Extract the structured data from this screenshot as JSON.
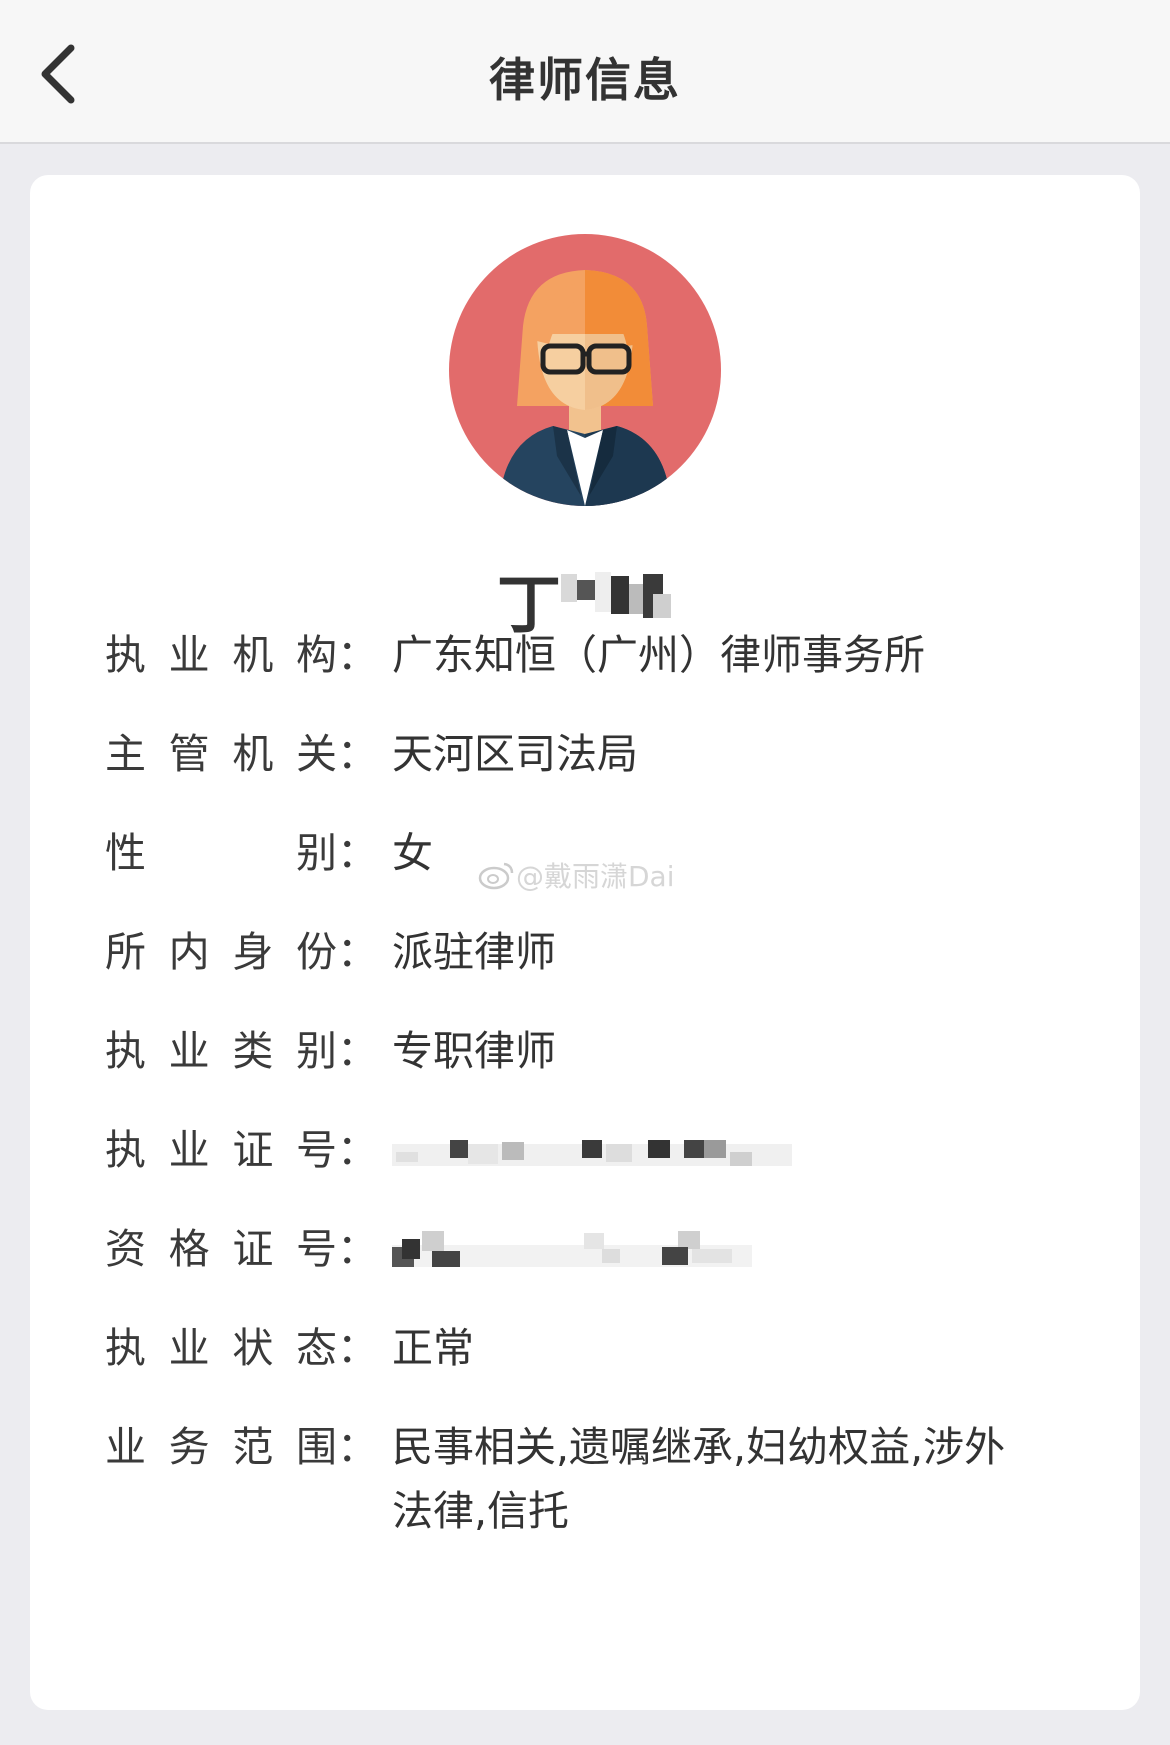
{
  "header": {
    "title": "律师信息",
    "back_icon": "chevron-left-icon"
  },
  "profile": {
    "avatar_icon": "female-lawyer-avatar-icon",
    "avatar_bg": "#e26b6b",
    "name_visible": "丁"
  },
  "fields": [
    {
      "label": [
        "执",
        "业",
        "机",
        "构"
      ],
      "colon": "：",
      "value": "广东知恒（广州）律师事务所"
    },
    {
      "label": [
        "主",
        "管",
        "机",
        "关"
      ],
      "colon": "：",
      "value": "天河区司法局"
    },
    {
      "label": [
        "性",
        "别"
      ],
      "colon": "：",
      "value": "女"
    },
    {
      "label": [
        "所",
        "内",
        "身",
        "份"
      ],
      "colon": "：",
      "value": "派驻律师"
    },
    {
      "label": [
        "执",
        "业",
        "类",
        "别"
      ],
      "colon": "：",
      "value": "专职律师"
    },
    {
      "label": [
        "执",
        "业",
        "证",
        "号"
      ],
      "colon": "：",
      "value": ""
    },
    {
      "label": [
        "资",
        "格",
        "证",
        "号"
      ],
      "colon": "：",
      "value": ""
    },
    {
      "label": [
        "执",
        "业",
        "状",
        "态"
      ],
      "colon": "：",
      "value": "正常"
    },
    {
      "label": [
        "业",
        "务",
        "范",
        "围"
      ],
      "colon": "：",
      "value_line1": "民事相关,遗嘱继承,妇幼权益,涉外",
      "value_line2": "法律,信托"
    }
  ],
  "watermark": {
    "text": "@戴雨潇Dai",
    "icon": "weibo-icon"
  }
}
